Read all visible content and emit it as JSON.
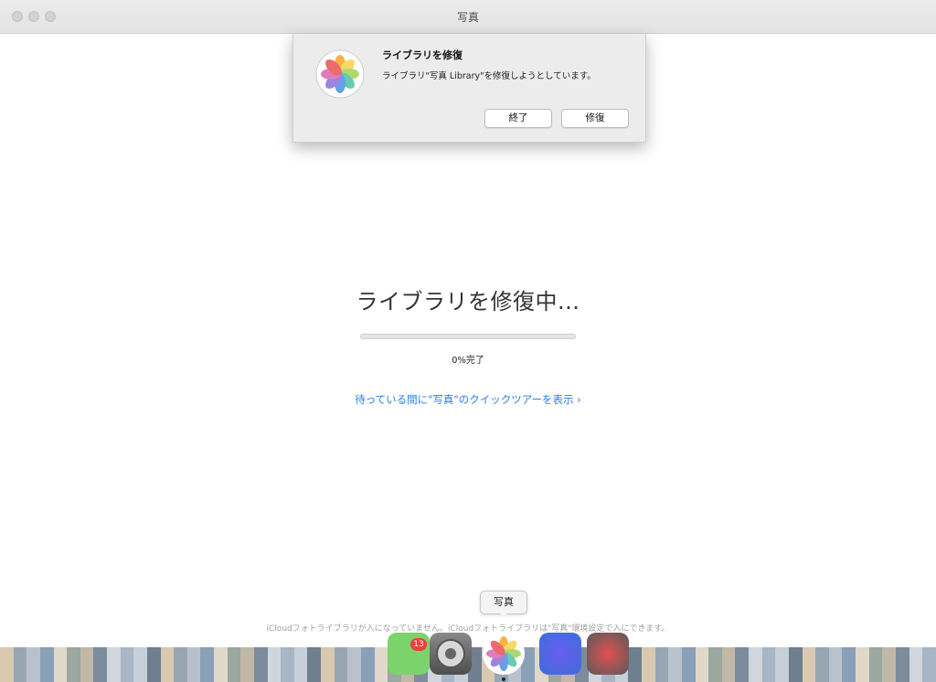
{
  "window": {
    "title": "写真"
  },
  "alert": {
    "icon": "photos-app-icon",
    "title": "ライブラリを修復",
    "message": "ライブラリ\"写真 Library\"を修復しようとしています。",
    "quit_label": "終了",
    "repair_label": "修復"
  },
  "main": {
    "heading": "ライブラリを修復中...",
    "progress_percent": 0,
    "progress_label": "0%完了",
    "tour_link": "待っている間に\"写真\"のクイックツアーを表示 ›",
    "footer_note": "iCloudフォトライブラリが入になっていません。iCloudフォトライブラリは\"写真\"環境設定で入にできます。"
  },
  "dock": {
    "tooltip": "写真",
    "badge_count": "13",
    "apps": [
      "messages-icon",
      "system-preferences-icon",
      "photos-app-icon",
      "app-icon",
      "app-icon"
    ]
  },
  "colors": {
    "accent": "#2a7de1",
    "progress": "#4a90e2",
    "badge": "#e8433a"
  }
}
